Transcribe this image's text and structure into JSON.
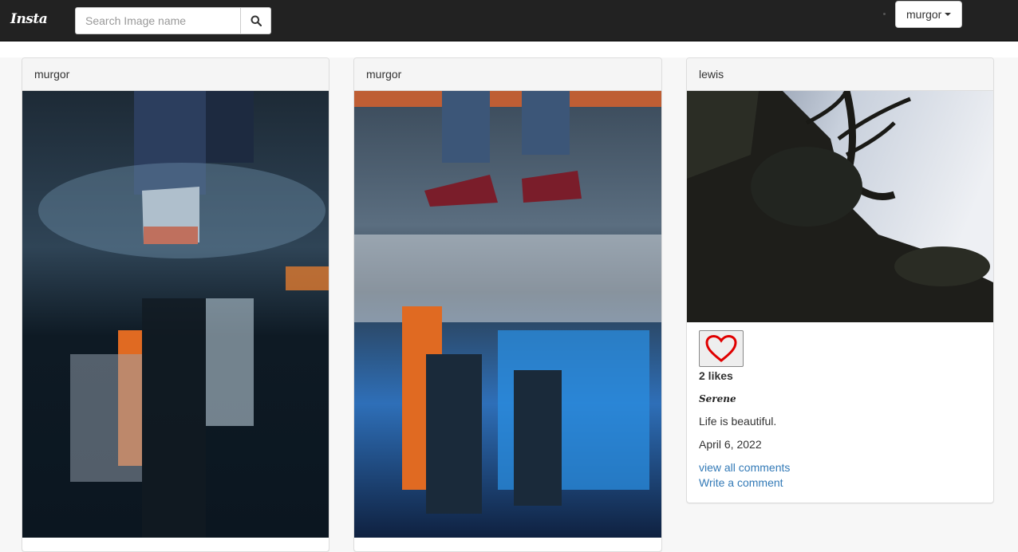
{
  "navbar": {
    "brand": "Insta",
    "search_placeholder": "Search Image name",
    "user_menu_label": "murgor",
    "icons": {
      "search": "search-icon",
      "caret": "caret-down-icon"
    }
  },
  "posts": [
    {
      "author": "murgor",
      "image": "feet splashing in puddle with reflection"
    },
    {
      "author": "murgor",
      "image": "sneakers stepping over puddle reflection"
    },
    {
      "author": "lewis",
      "image": "silhouetted tree against sky",
      "like_icon": "heart-icon",
      "likes": "2 likes",
      "title": "Serene",
      "caption": "Life is beautiful.",
      "date": "April 6, 2022",
      "view_comments_label": "view all comments",
      "write_comment_label": "Write a comment"
    }
  ],
  "colors": {
    "navbar": "#222222",
    "link": "#337ab7",
    "heart": "#e00000"
  }
}
